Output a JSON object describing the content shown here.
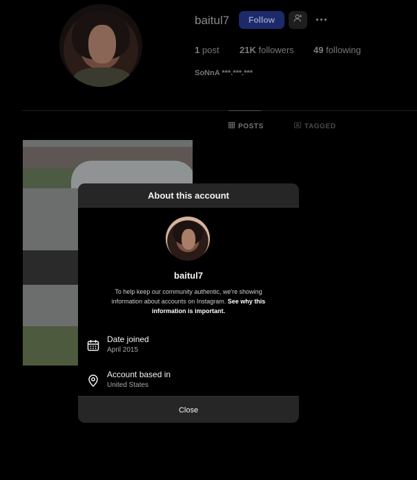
{
  "profile": {
    "username": "baitul7",
    "follow_label": "Follow",
    "stats": {
      "posts_count": "1",
      "posts_label": "post",
      "followers_count": "21K",
      "followers_label": "followers",
      "following_count": "49",
      "following_label": "following"
    },
    "full_name": "SoNnA ***.***.***"
  },
  "tabs": [
    {
      "label": "POSTS",
      "icon": "grid-icon",
      "active": true
    },
    {
      "label": "TAGGED",
      "icon": "tag-icon",
      "active": false
    }
  ],
  "modal": {
    "title": "About this account",
    "username": "baitul7",
    "description": "To help keep our community authentic, we're showing information about accounts on Instagram.",
    "link_text": "See why this information is important.",
    "date_joined": {
      "label": "Date joined",
      "value": "April 2015",
      "icon": "calendar-icon"
    },
    "based_in": {
      "label": "Account based in",
      "value": "United States",
      "icon": "location-pin-icon"
    },
    "close_label": "Close"
  },
  "colors": {
    "background": "#000000",
    "modal_header": "#262626",
    "follow_button": "#1d2a6a"
  }
}
